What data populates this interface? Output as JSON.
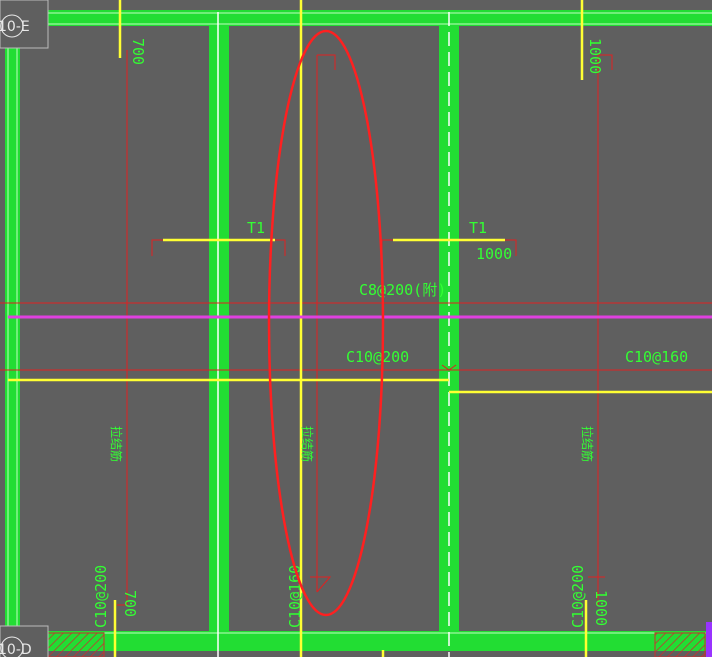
{
  "axis_labels": {
    "top_left": "10-E",
    "bottom_left": "10-D"
  },
  "beam_labels": {
    "t1_left": "T1",
    "t1_right": "T1"
  },
  "rebar_labels": {
    "c8_200_note": "C8@200(附)",
    "c10_200_mid": "C10@200",
    "c10_160_right": "C10@160",
    "c10_200_bottom_left": "C10@200",
    "c10_200_bottom_right": "C10@200",
    "c10_160_bottom_mid": "C10@160"
  },
  "dimensions": {
    "d700_top": "700",
    "d1000_top": "1000",
    "d1000_t1": "1000",
    "d700_bottom": "700",
    "d1000_bottom": "1000"
  },
  "vertical_notes": {
    "left": "拉结筋",
    "mid": "拉结筋",
    "right": "拉结筋"
  },
  "colors": {
    "background": "#5f5f5f",
    "beam": "#22dd33",
    "beam_edge": "#bfffbf",
    "rebar_red": "#e02020",
    "rebar_yellow": "#ffff33",
    "magenta": "#e040e0",
    "highlight_ellipse": "#ff2020",
    "hatch": "#c83030",
    "text_green": "#33ff33"
  }
}
